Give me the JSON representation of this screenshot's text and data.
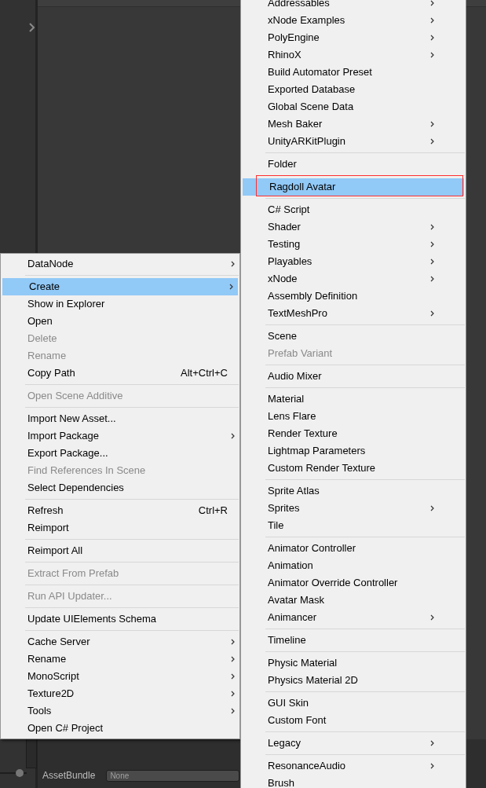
{
  "background": {
    "asset_bundle_label": "AssetBundle",
    "asset_bundle_value": "None",
    "zoom_slider": {
      "level": 0.85
    }
  },
  "context_menu": {
    "items": [
      {
        "kind": "item",
        "label": "DataNode",
        "selected": false,
        "disabled": false,
        "submenu": true
      },
      {
        "kind": "separator"
      },
      {
        "kind": "item",
        "label": "Create",
        "selected": true,
        "disabled": false,
        "submenu": true
      },
      {
        "kind": "item",
        "label": "Show in Explorer",
        "selected": false,
        "disabled": false,
        "submenu": false
      },
      {
        "kind": "item",
        "label": "Open",
        "selected": false,
        "disabled": false,
        "submenu": false
      },
      {
        "kind": "item",
        "label": "Delete",
        "selected": false,
        "disabled": true,
        "submenu": false
      },
      {
        "kind": "item",
        "label": "Rename",
        "selected": false,
        "disabled": true,
        "submenu": false
      },
      {
        "kind": "item",
        "label": "Copy Path",
        "selected": false,
        "disabled": false,
        "submenu": false,
        "shortcut": "Alt+Ctrl+C"
      },
      {
        "kind": "separator"
      },
      {
        "kind": "item",
        "label": "Open Scene Additive",
        "selected": false,
        "disabled": true,
        "submenu": false
      },
      {
        "kind": "separator"
      },
      {
        "kind": "item",
        "label": "Import New Asset...",
        "selected": false,
        "disabled": false,
        "submenu": false
      },
      {
        "kind": "item",
        "label": "Import Package",
        "selected": false,
        "disabled": false,
        "submenu": true
      },
      {
        "kind": "item",
        "label": "Export Package...",
        "selected": false,
        "disabled": false,
        "submenu": false
      },
      {
        "kind": "item",
        "label": "Find References In Scene",
        "selected": false,
        "disabled": true,
        "submenu": false
      },
      {
        "kind": "item",
        "label": "Select Dependencies",
        "selected": false,
        "disabled": false,
        "submenu": false
      },
      {
        "kind": "separator"
      },
      {
        "kind": "item",
        "label": "Refresh",
        "selected": false,
        "disabled": false,
        "submenu": false,
        "shortcut": "Ctrl+R"
      },
      {
        "kind": "item",
        "label": "Reimport",
        "selected": false,
        "disabled": false,
        "submenu": false
      },
      {
        "kind": "separator"
      },
      {
        "kind": "item",
        "label": "Reimport All",
        "selected": false,
        "disabled": false,
        "submenu": false
      },
      {
        "kind": "separator"
      },
      {
        "kind": "item",
        "label": "Extract From Prefab",
        "selected": false,
        "disabled": true,
        "submenu": false
      },
      {
        "kind": "separator"
      },
      {
        "kind": "item",
        "label": "Run API Updater...",
        "selected": false,
        "disabled": true,
        "submenu": false
      },
      {
        "kind": "separator"
      },
      {
        "kind": "item",
        "label": "Update UIElements Schema",
        "selected": false,
        "disabled": false,
        "submenu": false
      },
      {
        "kind": "separator"
      },
      {
        "kind": "item",
        "label": "Cache Server",
        "selected": false,
        "disabled": false,
        "submenu": true
      },
      {
        "kind": "item",
        "label": "Rename",
        "selected": false,
        "disabled": false,
        "submenu": true
      },
      {
        "kind": "item",
        "label": "MonoScript",
        "selected": false,
        "disabled": false,
        "submenu": true
      },
      {
        "kind": "item",
        "label": "Texture2D",
        "selected": false,
        "disabled": false,
        "submenu": true
      },
      {
        "kind": "item",
        "label": "Tools",
        "selected": false,
        "disabled": false,
        "submenu": true
      },
      {
        "kind": "item",
        "label": "Open C# Project",
        "selected": false,
        "disabled": false,
        "submenu": false
      }
    ]
  },
  "create_submenu": {
    "items": [
      {
        "kind": "item",
        "label": "Addressables",
        "selected": false,
        "disabled": false,
        "submenu": true,
        "outlined": false
      },
      {
        "kind": "item",
        "label": "xNode Examples",
        "selected": false,
        "disabled": false,
        "submenu": true,
        "outlined": false
      },
      {
        "kind": "item",
        "label": "PolyEngine",
        "selected": false,
        "disabled": false,
        "submenu": true,
        "outlined": false
      },
      {
        "kind": "item",
        "label": "RhinoX",
        "selected": false,
        "disabled": false,
        "submenu": true,
        "outlined": false
      },
      {
        "kind": "item",
        "label": "Build Automator Preset",
        "selected": false,
        "disabled": false,
        "submenu": false,
        "outlined": false
      },
      {
        "kind": "item",
        "label": "Exported Database",
        "selected": false,
        "disabled": false,
        "submenu": false,
        "outlined": false
      },
      {
        "kind": "item",
        "label": "Global Scene Data",
        "selected": false,
        "disabled": false,
        "submenu": false,
        "outlined": false
      },
      {
        "kind": "item",
        "label": "Mesh Baker",
        "selected": false,
        "disabled": false,
        "submenu": true,
        "outlined": false
      },
      {
        "kind": "item",
        "label": "UnityARKitPlugin",
        "selected": false,
        "disabled": false,
        "submenu": true,
        "outlined": false
      },
      {
        "kind": "separator"
      },
      {
        "kind": "item",
        "label": "Folder",
        "selected": false,
        "disabled": false,
        "submenu": false,
        "outlined": false
      },
      {
        "kind": "separator"
      },
      {
        "kind": "item",
        "label": "Ragdoll Avatar",
        "selected": true,
        "disabled": false,
        "submenu": false,
        "outlined": true
      },
      {
        "kind": "separator"
      },
      {
        "kind": "item",
        "label": "C# Script",
        "selected": false,
        "disabled": false,
        "submenu": false,
        "outlined": false
      },
      {
        "kind": "item",
        "label": "Shader",
        "selected": false,
        "disabled": false,
        "submenu": true,
        "outlined": false
      },
      {
        "kind": "item",
        "label": "Testing",
        "selected": false,
        "disabled": false,
        "submenu": true,
        "outlined": false
      },
      {
        "kind": "item",
        "label": "Playables",
        "selected": false,
        "disabled": false,
        "submenu": true,
        "outlined": false
      },
      {
        "kind": "item",
        "label": "xNode",
        "selected": false,
        "disabled": false,
        "submenu": true,
        "outlined": false
      },
      {
        "kind": "item",
        "label": "Assembly Definition",
        "selected": false,
        "disabled": false,
        "submenu": false,
        "outlined": false
      },
      {
        "kind": "item",
        "label": "TextMeshPro",
        "selected": false,
        "disabled": false,
        "submenu": true,
        "outlined": false
      },
      {
        "kind": "separator"
      },
      {
        "kind": "item",
        "label": "Scene",
        "selected": false,
        "disabled": false,
        "submenu": false,
        "outlined": false
      },
      {
        "kind": "item",
        "label": "Prefab Variant",
        "selected": false,
        "disabled": true,
        "submenu": false,
        "outlined": false
      },
      {
        "kind": "separator"
      },
      {
        "kind": "item",
        "label": "Audio Mixer",
        "selected": false,
        "disabled": false,
        "submenu": false,
        "outlined": false
      },
      {
        "kind": "separator"
      },
      {
        "kind": "item",
        "label": "Material",
        "selected": false,
        "disabled": false,
        "submenu": false,
        "outlined": false
      },
      {
        "kind": "item",
        "label": "Lens Flare",
        "selected": false,
        "disabled": false,
        "submenu": false,
        "outlined": false
      },
      {
        "kind": "item",
        "label": "Render Texture",
        "selected": false,
        "disabled": false,
        "submenu": false,
        "outlined": false
      },
      {
        "kind": "item",
        "label": "Lightmap Parameters",
        "selected": false,
        "disabled": false,
        "submenu": false,
        "outlined": false
      },
      {
        "kind": "item",
        "label": "Custom Render Texture",
        "selected": false,
        "disabled": false,
        "submenu": false,
        "outlined": false
      },
      {
        "kind": "separator"
      },
      {
        "kind": "item",
        "label": "Sprite Atlas",
        "selected": false,
        "disabled": false,
        "submenu": false,
        "outlined": false
      },
      {
        "kind": "item",
        "label": "Sprites",
        "selected": false,
        "disabled": false,
        "submenu": true,
        "outlined": false
      },
      {
        "kind": "item",
        "label": "Tile",
        "selected": false,
        "disabled": false,
        "submenu": false,
        "outlined": false
      },
      {
        "kind": "separator"
      },
      {
        "kind": "item",
        "label": "Animator Controller",
        "selected": false,
        "disabled": false,
        "submenu": false,
        "outlined": false
      },
      {
        "kind": "item",
        "label": "Animation",
        "selected": false,
        "disabled": false,
        "submenu": false,
        "outlined": false
      },
      {
        "kind": "item",
        "label": "Animator Override Controller",
        "selected": false,
        "disabled": false,
        "submenu": false,
        "outlined": false
      },
      {
        "kind": "item",
        "label": "Avatar Mask",
        "selected": false,
        "disabled": false,
        "submenu": false,
        "outlined": false
      },
      {
        "kind": "item",
        "label": "Animancer",
        "selected": false,
        "disabled": false,
        "submenu": true,
        "outlined": false
      },
      {
        "kind": "separator"
      },
      {
        "kind": "item",
        "label": "Timeline",
        "selected": false,
        "disabled": false,
        "submenu": false,
        "outlined": false
      },
      {
        "kind": "separator"
      },
      {
        "kind": "item",
        "label": "Physic Material",
        "selected": false,
        "disabled": false,
        "submenu": false,
        "outlined": false
      },
      {
        "kind": "item",
        "label": "Physics Material 2D",
        "selected": false,
        "disabled": false,
        "submenu": false,
        "outlined": false
      },
      {
        "kind": "separator"
      },
      {
        "kind": "item",
        "label": "GUI Skin",
        "selected": false,
        "disabled": false,
        "submenu": false,
        "outlined": false
      },
      {
        "kind": "item",
        "label": "Custom Font",
        "selected": false,
        "disabled": false,
        "submenu": false,
        "outlined": false
      },
      {
        "kind": "separator"
      },
      {
        "kind": "item",
        "label": "Legacy",
        "selected": false,
        "disabled": false,
        "submenu": true,
        "outlined": false
      },
      {
        "kind": "separator"
      },
      {
        "kind": "item",
        "label": "ResonanceAudio",
        "selected": false,
        "disabled": false,
        "submenu": true,
        "outlined": false
      },
      {
        "kind": "item",
        "label": "Brush",
        "selected": false,
        "disabled": false,
        "submenu": false,
        "outlined": false
      }
    ]
  }
}
